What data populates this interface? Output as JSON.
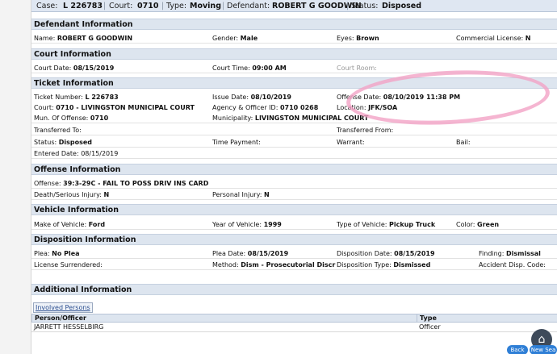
{
  "case_header": {
    "case_label": "Case:",
    "case_value": "L 226783",
    "court_label": "Court:",
    "court_value": "0710",
    "type_label": "Type:",
    "type_value": "Moving",
    "defendant_label": "Defendant:",
    "defendant_value": "ROBERT G GOODWIN",
    "status_label": "Status:",
    "status_value": "Disposed"
  },
  "defendant": {
    "title": "Defendant Information",
    "name_label": "Name:",
    "name": "ROBERT G GOODWIN",
    "gender_label": "Gender:",
    "gender": "Male",
    "eyes_label": "Eyes:",
    "eyes": "Brown",
    "license_label": "Commercial License:",
    "license": "N"
  },
  "court": {
    "title": "Court Information",
    "date_label": "Court Date:",
    "date": "08/15/2019",
    "time_label": "Court Time:",
    "time": "09:00 AM",
    "room_label": "Court Room:"
  },
  "ticket": {
    "title": "Ticket Information",
    "number_label": "Ticket Number:",
    "number": "L 226783",
    "issue_label": "Issue Date:",
    "issue": "08/10/2019",
    "offense_date_label": "Offense Date:",
    "offense_date": "08/10/2019 11:38 PM",
    "court_label": "Court:",
    "court": "0710 - LIVINGSTON MUNICIPAL COURT",
    "agency_label": "Agency & Officer ID:",
    "agency": "0710 0268",
    "location_label": "Location:",
    "location": "JFK/SOA",
    "mun_label": "Mun. Of Offense:",
    "mun": "0710",
    "municipality_label": "Municipality:",
    "municipality": "LIVINGSTON MUNICIPAL COURT",
    "transferred_to_label": "Transferred To:",
    "transferred_from_label": "Transferred From:",
    "status_label": "Status:",
    "status": "Disposed",
    "payment_label": "Time Payment:",
    "warrant_label": "Warrant:",
    "bail_label": "Bail:",
    "entered_label": "Entered Date:",
    "entered": "08/15/2019"
  },
  "offense": {
    "title": "Offense Information",
    "offense_label": "Offense:",
    "offense": "39:3-29C - FAIL TO POSS DRIV INS CARD",
    "death_label": "Death/Serious Injury:",
    "death": "N",
    "injury_label": "Personal Injury:",
    "injury": "N"
  },
  "vehicle": {
    "title": "Vehicle Information",
    "make_label": "Make of Vehicle:",
    "make": "Ford",
    "year_label": "Year of Vehicle:",
    "year": "1999",
    "type_label": "Type of Vehicle:",
    "type": "Pickup Truck",
    "color_label": "Color:",
    "color": "Green"
  },
  "disposition": {
    "title": "Disposition Information",
    "plea_label": "Plea:",
    "plea": "No Plea",
    "plea_date_label": "Plea Date:",
    "plea_date": "08/15/2019",
    "disp_date_label": "Disposition Date:",
    "disp_date": "08/15/2019",
    "finding_label": "Finding:",
    "finding": "Dismissal",
    "license_label": "License Surrendered:",
    "method_label": "Method:",
    "method": "Dism - Prosecutorial Discr",
    "disp_type_label": "Disposition Type:",
    "disp_type": "Dismissed",
    "accident_label": "Accident Disp. Code:"
  },
  "additional": {
    "title": "Additional Information",
    "tab_label": "Involved Persons",
    "columns": [
      "Person/Officer",
      "Type"
    ],
    "rows": [
      [
        "JARRETT HESSELBIRG",
        "Officer"
      ]
    ]
  },
  "footer": {
    "back_label": "Back",
    "new_label": "New Sea"
  },
  "colors": {
    "section_bg": "#dde5ef",
    "annotation": "#f2a3c6",
    "button": "#2f7fd6"
  }
}
